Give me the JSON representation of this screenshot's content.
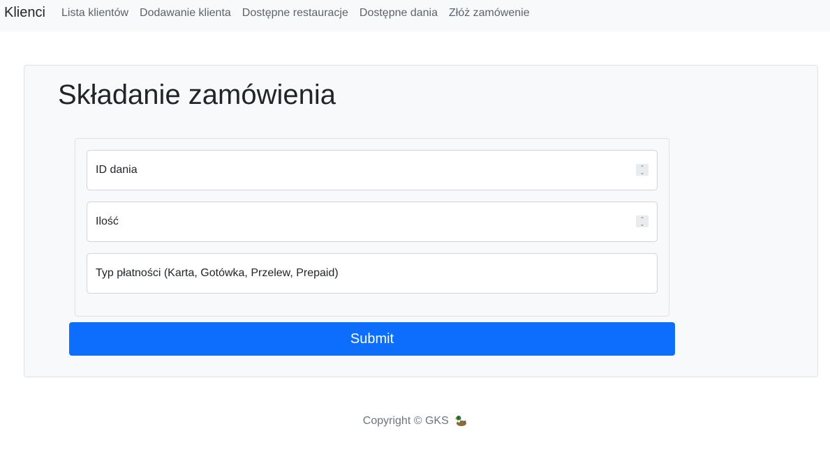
{
  "navbar": {
    "brand": "Klienci",
    "links": [
      {
        "label": "Lista klientów"
      },
      {
        "label": "Dodawanie klienta"
      },
      {
        "label": "Dostępne restauracje"
      },
      {
        "label": "Dostępne dania"
      },
      {
        "label": "Złóż zamówenie"
      }
    ]
  },
  "main": {
    "title": "Składanie zamówienia",
    "form": {
      "fields": [
        {
          "placeholder": "ID dania",
          "type": "number",
          "value": ""
        },
        {
          "placeholder": "Ilość",
          "type": "number",
          "value": ""
        },
        {
          "placeholder": "Typ płatności (Karta, Gotówka, Przelew, Prepaid)",
          "type": "text",
          "value": ""
        }
      ],
      "submit_label": "Submit"
    }
  },
  "footer": {
    "text": "Copyright © GKS",
    "icon": "duck-icon"
  },
  "colors": {
    "primary": "#0d6efd",
    "navbar_bg": "#f8f9fa",
    "panel_bg": "#f8f9fa"
  }
}
